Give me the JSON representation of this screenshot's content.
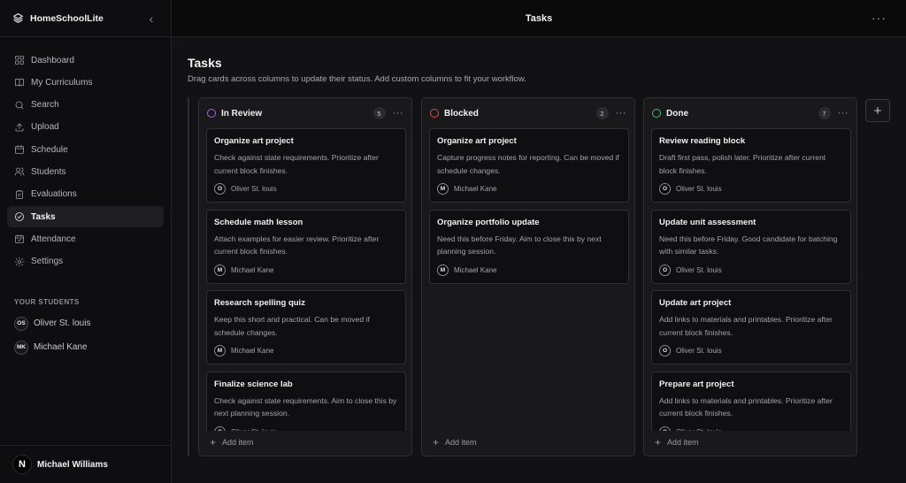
{
  "app": {
    "brand": "HomeSchoolLite"
  },
  "topbar": {
    "title": "Tasks"
  },
  "nav": [
    {
      "id": "dashboard",
      "label": "Dashboard",
      "icon": "grid-icon"
    },
    {
      "id": "curriculums",
      "label": "My Curriculums",
      "icon": "book-icon"
    },
    {
      "id": "search",
      "label": "Search",
      "icon": "search-icon"
    },
    {
      "id": "upload",
      "label": "Upload",
      "icon": "upload-icon"
    },
    {
      "id": "schedule",
      "label": "Schedule",
      "icon": "calendar-icon"
    },
    {
      "id": "students",
      "label": "Students",
      "icon": "users-icon"
    },
    {
      "id": "evaluations",
      "label": "Evaluations",
      "icon": "clipboard-icon"
    },
    {
      "id": "tasks",
      "label": "Tasks",
      "icon": "check-circle-icon",
      "active": true
    },
    {
      "id": "attendance",
      "label": "Attendance",
      "icon": "calendar-check-icon"
    },
    {
      "id": "settings",
      "label": "Settings",
      "icon": "gear-icon"
    }
  ],
  "students_section": {
    "heading": "YOUR STUDENTS",
    "students": [
      {
        "initials": "OS",
        "name": "Oliver St. louis"
      },
      {
        "initials": "MK",
        "name": "Michael Kane"
      }
    ]
  },
  "user": {
    "initial": "N",
    "name": "Michael Williams"
  },
  "page": {
    "title": "Tasks",
    "description": "Drag cards across columns to update their status. Add custom columns to fit your workflow."
  },
  "add_item_label": "Add item",
  "add_column_label": "+",
  "columns": [
    {
      "name": "In Review",
      "count": "5",
      "color": "#b15cf0",
      "cards": [
        {
          "title": "Organize art project",
          "desc": "Check against state requirements. Prioritize after current block finishes.",
          "assignee_initial": "O",
          "assignee": "Oliver St. louis"
        },
        {
          "title": "Schedule math lesson",
          "desc": "Attach examples for easier review. Prioritize after current block finishes.",
          "assignee_initial": "M",
          "assignee": "Michael Kane"
        },
        {
          "title": "Research spelling quiz",
          "desc": "Keep this short and practical. Can be moved if schedule changes.",
          "assignee_initial": "M",
          "assignee": "Michael Kane"
        },
        {
          "title": "Finalize science lab",
          "desc": "Check against state requirements. Aim to close this by next planning session.",
          "assignee_initial": "O",
          "assignee": "Oliver St. louis"
        }
      ]
    },
    {
      "name": "Blocked",
      "count": "2",
      "color": "#e5484d",
      "cards": [
        {
          "title": "Organize art project",
          "desc": "Capture progress notes for reporting. Can be moved if schedule changes.",
          "assignee_initial": "M",
          "assignee": "Michael Kane"
        },
        {
          "title": "Organize portfolio update",
          "desc": "Need this before Friday. Aim to close this by next planning session.",
          "assignee_initial": "M",
          "assignee": "Michael Kane"
        }
      ]
    },
    {
      "name": "Done",
      "count": "7",
      "color": "#3ec46d",
      "cards": [
        {
          "title": "Review reading block",
          "desc": "Draft first pass, polish later. Prioritize after current block finishes.",
          "assignee_initial": "O",
          "assignee": "Oliver St. louis"
        },
        {
          "title": "Update unit assessment",
          "desc": "Need this before Friday. Good candidate for batching with similar tasks.",
          "assignee_initial": "O",
          "assignee": "Oliver St. louis"
        },
        {
          "title": "Update art project",
          "desc": "Add links to materials and printables. Prioritize after current block finishes.",
          "assignee_initial": "O",
          "assignee": "Oliver St. louis"
        },
        {
          "title": "Prepare art project",
          "desc": "Add links to materials and printables. Prioritize after current block finishes.",
          "assignee_initial": "O",
          "assignee": "Oliver St. louis"
        }
      ]
    }
  ]
}
